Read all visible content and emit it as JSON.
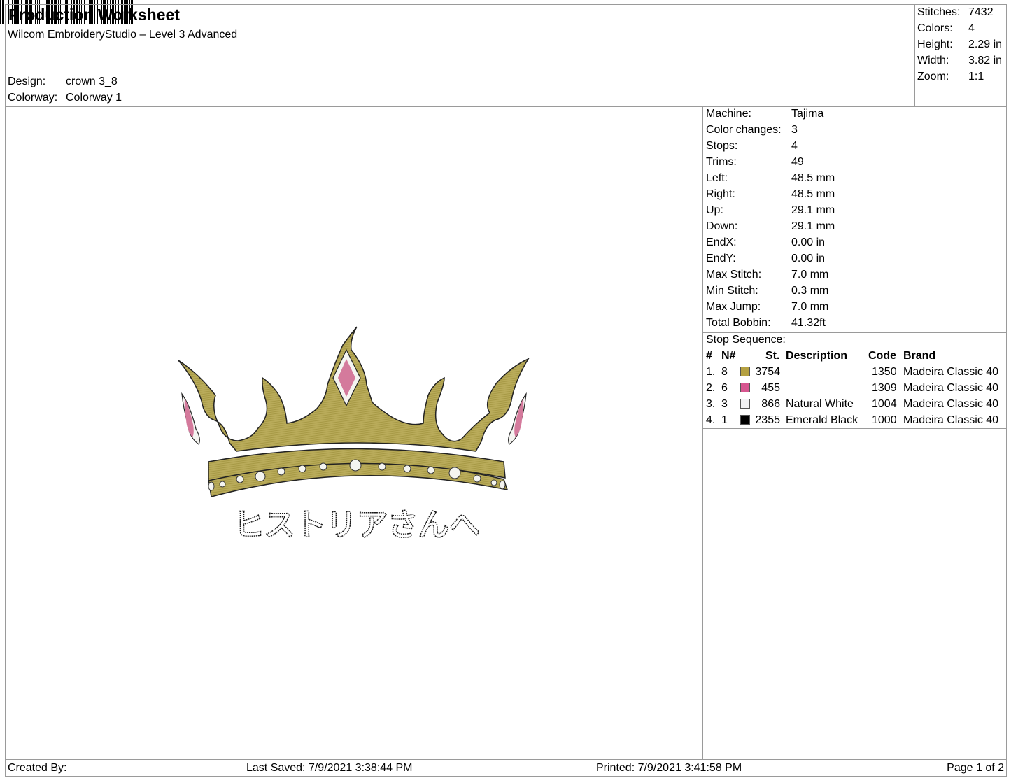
{
  "header": {
    "title": "Production Worksheet",
    "software": "Wilcom EmbroideryStudio – Level 3 Advanced",
    "design_label": "Design:",
    "design_value": "crown 3_8",
    "colorway_label": "Colorway:",
    "colorway_value": "Colorway 1"
  },
  "stats": [
    {
      "label": "Stitches:",
      "value": "7432"
    },
    {
      "label": "Colors:",
      "value": "4"
    },
    {
      "label": "Height:",
      "value": "2.29 in"
    },
    {
      "label": "Width:",
      "value": "3.82 in"
    },
    {
      "label": "Zoom:",
      "value": "1:1"
    }
  ],
  "machine": [
    {
      "label": "Machine:",
      "value": "Tajima"
    },
    {
      "label": "Color changes:",
      "value": "3"
    },
    {
      "label": "Stops:",
      "value": "4"
    },
    {
      "label": "Trims:",
      "value": "49"
    },
    {
      "label": "Left:",
      "value": "48.5 mm"
    },
    {
      "label": "Right:",
      "value": "48.5 mm"
    },
    {
      "label": "Up:",
      "value": "29.1 mm"
    },
    {
      "label": "Down:",
      "value": "29.1 mm"
    },
    {
      "label": "EndX:",
      "value": "0.00 in"
    },
    {
      "label": "EndY:",
      "value": "0.00 in"
    },
    {
      "label": "Max Stitch:",
      "value": "7.0 mm"
    },
    {
      "label": "Min Stitch:",
      "value": "0.3 mm"
    },
    {
      "label": "Max Jump:",
      "value": "7.0 mm"
    },
    {
      "label": "Total Bobbin:",
      "value": "41.32ft"
    }
  ],
  "stop_sequence": {
    "title": "Stop Sequence:",
    "headers": {
      "num": "#",
      "n": "N#",
      "st": "St.",
      "description": "Description",
      "code": "Code",
      "brand": "Brand"
    },
    "rows": [
      {
        "num": "1.",
        "n": "8",
        "color": "#b5a142",
        "st": "3754",
        "description": "",
        "code": "1350",
        "brand": "Madeira Classic 40"
      },
      {
        "num": "2.",
        "n": "6",
        "color": "#d6558f",
        "st": "455",
        "description": "",
        "code": "1309",
        "brand": "Madeira Classic 40"
      },
      {
        "num": "3.",
        "n": "3",
        "color": "#f2f2f4",
        "st": "866",
        "description": "Natural White",
        "code": "1004",
        "brand": "Madeira Classic 40"
      },
      {
        "num": "4.",
        "n": "1",
        "color": "#000000",
        "st": "2355",
        "description": "Emerald Black",
        "code": "1000",
        "brand": "Madeira Classic 40"
      }
    ]
  },
  "design_text": "ヒストリアさんへ",
  "footer": {
    "created_by": "Created By:",
    "last_saved": "Last Saved: 7/9/2021 3:38:44 PM",
    "printed": "Printed: 7/9/2021 3:41:58 PM",
    "page": "Page 1 of 2"
  },
  "colors": {
    "crown_gold": "#b9ab5a",
    "jewel_pink": "#d47a9c",
    "jewel_white": "#f4f4f0",
    "outline": "#222222"
  }
}
